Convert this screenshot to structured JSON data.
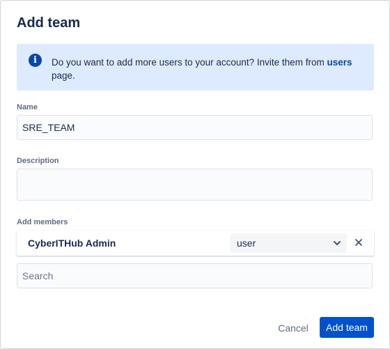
{
  "dialog": {
    "title": "Add team",
    "info": {
      "text_before": "Do you want to add more users to your account? Invite them from ",
      "link": "users",
      "text_after": " page."
    },
    "name": {
      "label": "Name",
      "value": "SRE_TEAM"
    },
    "description": {
      "label": "Description",
      "value": ""
    },
    "members": {
      "label": "Add members",
      "rows": [
        {
          "name": "CyberITHub Admin",
          "role": "user"
        }
      ],
      "search_placeholder": "Search"
    },
    "buttons": {
      "cancel": "Cancel",
      "submit": "Add team"
    }
  },
  "colors": {
    "primary": "#0052cc",
    "info_bg": "#deebff",
    "info_icon": "#0747a6",
    "text": "#172b4d",
    "label": "#5e6c84"
  },
  "icons": {
    "info": "info-icon",
    "dropdown": "chevron-down-icon",
    "remove": "close-icon"
  }
}
